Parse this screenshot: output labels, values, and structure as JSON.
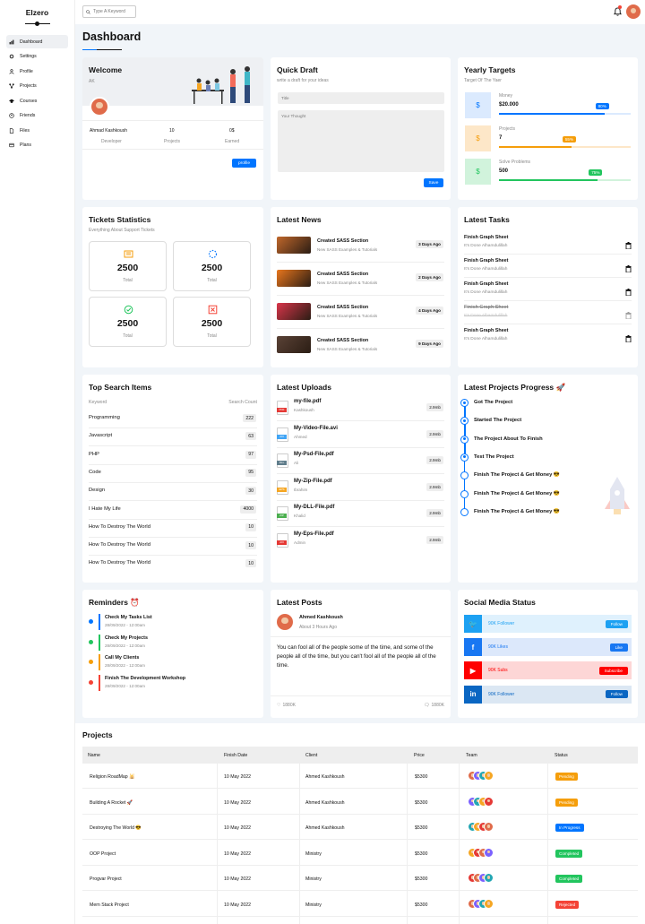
{
  "brand": "Elzero",
  "search": {
    "placeholder": "Type A Keyword"
  },
  "nav": [
    {
      "label": "Dashboard",
      "icon": "chart-icon",
      "active": true
    },
    {
      "label": "Settings",
      "icon": "gear-icon"
    },
    {
      "label": "Profile",
      "icon": "user-icon"
    },
    {
      "label": "Projects",
      "icon": "diagram-icon"
    },
    {
      "label": "Courses",
      "icon": "graduation-icon"
    },
    {
      "label": "Friends",
      "icon": "friends-icon"
    },
    {
      "label": "Files",
      "icon": "file-icon"
    },
    {
      "label": "Plans",
      "icon": "credit-card-icon"
    }
  ],
  "page_title": "Dashboard",
  "welcome": {
    "title": "Welcome",
    "subtitle": "AK",
    "name": "Ahmad Kashkoush",
    "role": "Developer",
    "projects": "10",
    "projects_label": "Projects",
    "earned": "0$",
    "earned_label": "Earned",
    "button": "profile"
  },
  "quick_draft": {
    "title": "Quick Draft",
    "subtitle": "write a draft for your ideas",
    "title_placeholder": "Title",
    "thought_placeholder": "Your Thought",
    "button": "Save"
  },
  "yearly": {
    "title": "Yearly Targets",
    "subtitle": "Target Of The Yaer",
    "items": [
      {
        "label": "Money",
        "value": "$20.000",
        "percent": "80%",
        "fill": 0.8,
        "color": "#0075ff",
        "bg": "#dbeafe",
        "icon": "$"
      },
      {
        "label": "Projects",
        "value": "7",
        "percent": "55%",
        "fill": 0.55,
        "color": "#f59e0b",
        "bg": "#fde7c8",
        "icon": "$"
      },
      {
        "label": "Solve Problems",
        "value": "500",
        "percent": "75%",
        "fill": 0.75,
        "color": "#22c55e",
        "bg": "#d1f3dc",
        "icon": "$"
      }
    ]
  },
  "tickets": {
    "title": "Tickets Statistics",
    "subtitle": "Everything About Support Tickets",
    "items": [
      {
        "value": "2500",
        "label": "Total",
        "icon": "list-icon",
        "color": "#f59e0b"
      },
      {
        "value": "2500",
        "label": "Total",
        "icon": "spinner-icon",
        "color": "#0075ff"
      },
      {
        "value": "2500",
        "label": "Total",
        "icon": "check-circle-icon",
        "color": "#22c55e"
      },
      {
        "value": "2500",
        "label": "Total",
        "icon": "x-square-icon",
        "color": "#f44336"
      }
    ]
  },
  "news": {
    "title": "Latest News",
    "items": [
      {
        "title": "Created SASS Section",
        "sub": "New SASS Examples & Tutorials",
        "badge": "3 Days Ago",
        "color": "#c0672b"
      },
      {
        "title": "Created SASS Section",
        "sub": "New SASS Examples & Tutorials",
        "badge": "2 Days Ago",
        "color": "#e8761d"
      },
      {
        "title": "Created SASS Section",
        "sub": "New SASS Examples & Tutorials",
        "badge": "4 Days Ago",
        "color": "#d9354a"
      },
      {
        "title": "Created SASS Section",
        "sub": "New SASS Examples & Tutorials",
        "badge": "9 Days Ago",
        "color": "#5a4236"
      }
    ]
  },
  "tasks": {
    "title": "Latest Tasks",
    "items": [
      {
        "title": "Finish Graph Sheet",
        "sub": "It's Done Alhamdulillah",
        "done": false
      },
      {
        "title": "Finish Graph Sheet",
        "sub": "It's Done Alhamdulillah",
        "done": false
      },
      {
        "title": "Finish Graph Sheet",
        "sub": "It's Done Alhamdulillah",
        "done": false
      },
      {
        "title": "Finish Graph Sheet",
        "sub": "It's Done Alhamdulillah",
        "done": true
      },
      {
        "title": "Finish Graph Sheet",
        "sub": "It's Done Alhamdulillah",
        "done": false
      }
    ]
  },
  "top_search": {
    "title": "Top Search Items",
    "col1": "Keyword",
    "col2": "Search Count",
    "rows": [
      {
        "k": "Programming",
        "v": "222"
      },
      {
        "k": "Javascript",
        "v": "63"
      },
      {
        "k": "PHP",
        "v": "97"
      },
      {
        "k": "Code",
        "v": "95"
      },
      {
        "k": "Design",
        "v": "30"
      },
      {
        "k": "I Hate My Life",
        "v": "4000"
      },
      {
        "k": "How To Destroy The World",
        "v": "10"
      },
      {
        "k": "How To Destroy The World",
        "v": "10"
      },
      {
        "k": "How To Destroy The World",
        "v": "10"
      }
    ]
  },
  "uploads": {
    "title": "Latest Uploads",
    "items": [
      {
        "name": "my-file.pdf",
        "by": "Kashkoush",
        "size": "2.9mb",
        "type": "PDF",
        "color": "#e53935"
      },
      {
        "name": "My-Video-File.avi",
        "by": "Ahmed",
        "size": "2.9mb",
        "type": "AVI",
        "color": "#42a5f5"
      },
      {
        "name": "My-Psd-File.pdf",
        "by": "Ali",
        "size": "2.9mb",
        "type": "DLL",
        "color": "#607d8b"
      },
      {
        "name": "My-Zip-File.pdf",
        "by": "Ibrahim",
        "size": "2.9mb",
        "type": "EPS",
        "color": "#f5a623"
      },
      {
        "name": "My-DLL-File.pdf",
        "by": "Khalid",
        "size": "2.9mb",
        "type": "ZIP",
        "color": "#4caf50"
      },
      {
        "name": "My-Eps-File.pdf",
        "by": "Admin",
        "size": "2.9mb",
        "type": "AVI",
        "color": "#e53935"
      }
    ]
  },
  "progress": {
    "title": "Latest Projects Progress 🚀",
    "items": [
      {
        "label": "Got The Project",
        "done": true
      },
      {
        "label": "Started The Project",
        "done": true
      },
      {
        "label": "The Project About To Finish",
        "done": true
      },
      {
        "label": "Test The Project",
        "done": true
      },
      {
        "label": "Finish The Project & Get Money 😎",
        "done": false
      },
      {
        "label": "Finish The Project & Get Money 😎",
        "done": false
      },
      {
        "label": "Finish The Project & Get Money 😎",
        "done": false
      }
    ]
  },
  "reminders": {
    "title": "Reminders ⏰",
    "items": [
      {
        "title": "Check My Tasks List",
        "date": "28/09/2022 - 12:00am",
        "color": "#0075ff"
      },
      {
        "title": "Check My Projects",
        "date": "28/09/2022 - 12:00am",
        "color": "#22c55e"
      },
      {
        "title": "Call My Clients",
        "date": "28/09/2022 - 12:00am",
        "color": "#f59e0b"
      },
      {
        "title": "Finish The Development Workshop",
        "date": "28/09/2022 - 12:00am",
        "color": "#f44336"
      }
    ]
  },
  "posts": {
    "title": "Latest Posts",
    "author": "Ahmed Kashkoush",
    "time": "About 3 Hours Ago",
    "text": "You can fool all of the people some of the time, and some of the people all of the time, but you can't fool all of the people all of the time.",
    "likes": "1880K",
    "comments": "1880K"
  },
  "social": {
    "title": "Social Media Status",
    "items": [
      {
        "icon": "twitter-icon",
        "glyph": "🐦",
        "text": "90K Follower",
        "btn": "Follow",
        "color": "#1da1f2",
        "bg": "#dff1fd"
      },
      {
        "icon": "facebook-icon",
        "glyph": "f",
        "text": "90K Likes",
        "btn": "Like",
        "color": "#1877f2",
        "bg": "#dce8fb"
      },
      {
        "icon": "youtube-icon",
        "glyph": "▶",
        "text": "90K Subs",
        "btn": "Subscribe",
        "color": "#ff0000",
        "bg": "#fdd6d6"
      },
      {
        "icon": "linkedin-icon",
        "glyph": "in",
        "text": "90K Follower",
        "btn": "Follow",
        "color": "#0a66c2",
        "bg": "#dbe7f3"
      }
    ]
  },
  "projects": {
    "title": "Projects",
    "cols": [
      "Name",
      "Finish Date",
      "Client",
      "Price",
      "Team",
      "Status"
    ],
    "rows": [
      {
        "name": "Religion RoadMap 🕌",
        "date": "10 May 2022",
        "client": "Ahmed Kashkoush",
        "price": "$5300",
        "status": "Pending",
        "color": "#f59e0b"
      },
      {
        "name": "Building A Rocket 🚀",
        "date": "10 May 2022",
        "client": "Ahmed Kashkoush",
        "price": "$5300",
        "status": "Pending",
        "color": "#f59e0b"
      },
      {
        "name": "Destroying The World 😎",
        "date": "10 May 2022",
        "client": "Ahmed Kashkoush",
        "price": "$5300",
        "status": "In Progress",
        "color": "#0075ff"
      },
      {
        "name": "OOP Project",
        "date": "10 May 2022",
        "client": "Ministry",
        "price": "$5300",
        "status": "Completed",
        "color": "#22c55e"
      },
      {
        "name": "Progvar Project",
        "date": "10 May 2022",
        "client": "Ministry",
        "price": "$5300",
        "status": "Completed",
        "color": "#22c55e"
      },
      {
        "name": "Mern Stack Project",
        "date": "10 May 2022",
        "client": "Ministry",
        "price": "$5300",
        "status": "Rejected",
        "color": "#f44336"
      }
    ]
  }
}
